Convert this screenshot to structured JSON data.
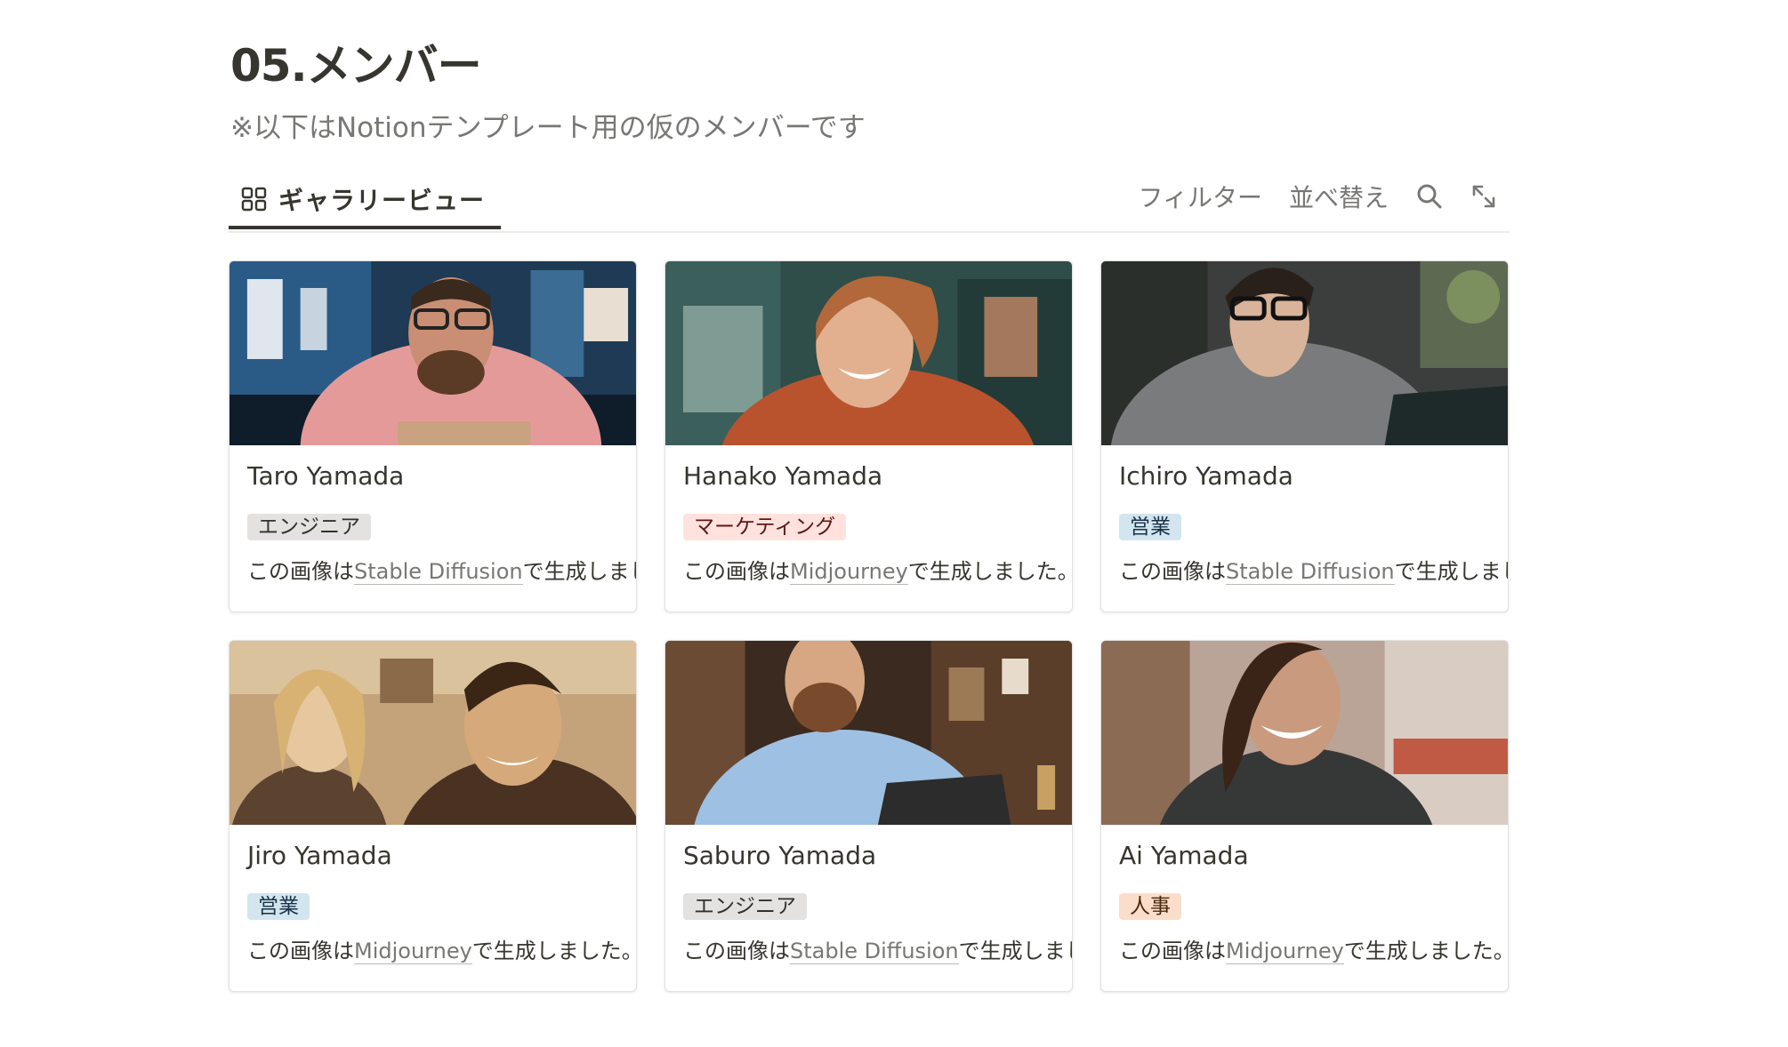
{
  "page": {
    "title": "05.メンバー",
    "subtitle": "※以下はNotionテンプレート用の仮のメンバーです"
  },
  "view": {
    "tab_label": "ギャラリービュー",
    "tab_icon": "gallery-grid-icon",
    "filter_label": "フィルター",
    "sort_label": "並べ替え",
    "search_icon": "search-icon",
    "expand_icon": "expand-icon"
  },
  "colors": {
    "text": "#37352f",
    "muted": "#787774",
    "tag_engineer_bg": "#e3e2e0",
    "tag_marketing_bg": "#ffe2dd",
    "tag_sales_bg": "#d3e5ef",
    "tag_hr_bg": "#fadec9"
  },
  "cards": [
    {
      "name": "Taro Yamada",
      "tag": "エンジニア",
      "tag_type": "engineer",
      "desc_prefix": "この画像は",
      "desc_link": "Stable Diffusion",
      "desc_suffix": "で生成しまし"
    },
    {
      "name": "Hanako Yamada",
      "tag": "マーケティング",
      "tag_type": "marketing",
      "desc_prefix": "この画像は",
      "desc_link": "Midjourney",
      "desc_suffix": "で生成しました。"
    },
    {
      "name": "Ichiro Yamada",
      "tag": "営業",
      "tag_type": "sales",
      "desc_prefix": "この画像は",
      "desc_link": "Stable Diffusion",
      "desc_suffix": "で生成しまし"
    },
    {
      "name": "Jiro Yamada",
      "tag": "営業",
      "tag_type": "sales",
      "desc_prefix": "この画像は",
      "desc_link": "Midjourney",
      "desc_suffix": "で生成しました。"
    },
    {
      "name": "Saburo Yamada",
      "tag": "エンジニア",
      "tag_type": "engineer",
      "desc_prefix": "この画像は",
      "desc_link": "Stable Diffusion",
      "desc_suffix": "で生成しまし"
    },
    {
      "name": "Ai Yamada",
      "tag": "人事",
      "tag_type": "hr",
      "desc_prefix": "この画像は",
      "desc_link": "Midjourney",
      "desc_suffix": "で生成しました。"
    }
  ]
}
